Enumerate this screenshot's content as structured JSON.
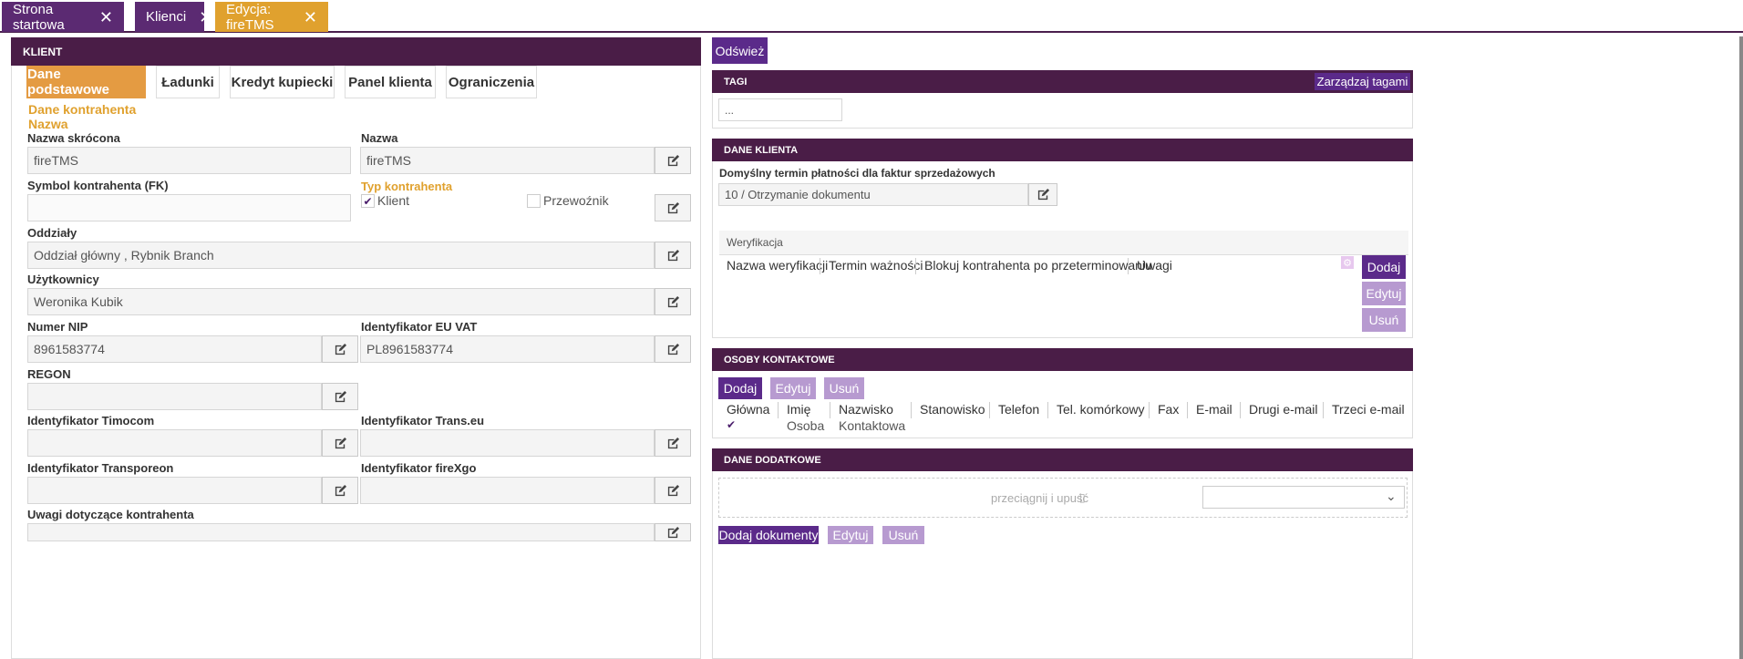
{
  "top_tabs": [
    {
      "label": "Strona startowa"
    },
    {
      "label": "Klienci"
    },
    {
      "label": "Edycja: fireTMS"
    }
  ],
  "left_panel": {
    "title": "KLIENT",
    "tabs": [
      "Dane podstawowe",
      "Ładunki",
      "Kredyt kupiecki",
      "Panel klienta",
      "Ograniczenia"
    ],
    "section_title": "Dane kontrahenta",
    "section_sub": "Nazwa",
    "fields": {
      "nazwa_skrocona_label": "Nazwa skrócona",
      "nazwa_skrocona_value": "fireTMS",
      "nazwa_label": "Nazwa",
      "nazwa_value": "fireTMS",
      "symbol_label": "Symbol kontrahenta (FK)",
      "symbol_value": "",
      "typ_label": "Typ kontrahenta",
      "klient_label": "Klient",
      "przewoznik_label": "Przewoźnik",
      "oddzialy_label": "Oddziały",
      "oddzialy_value": "Oddział główny , Rybnik Branch",
      "uzytkownicy_label": "Użytkownicy",
      "uzytkownicy_value": "Weronika Kubik",
      "nip_label": "Numer NIP",
      "nip_value": "8961583774",
      "euvat_label": "Identyfikator EU VAT",
      "euvat_value": "PL8961583774",
      "regon_label": "REGON",
      "regon_value": "",
      "timocom_label": "Identyfikator Timocom",
      "transeu_label": "Identyfikator Trans.eu",
      "transporeon_label": "Identyfikator Transporeon",
      "firexgo_label": "Identyfikator fireXgo",
      "uwagi_label": "Uwagi dotyczące kontrahenta"
    }
  },
  "right": {
    "refresh_label": "Odśwież",
    "tags": {
      "title": "TAGI",
      "manage_label": "Zarządzaj tagami",
      "input_value": "..."
    },
    "client_data": {
      "title": "DANE KLIENTA",
      "payment_label": "Domyślny termin płatności dla faktur sprzedażowych",
      "payment_value": "10 / Otrzymanie dokumentu",
      "verification_title": "Weryfikacja",
      "columns": [
        "Nazwa weryfikacji",
        "Termin ważności",
        "Blokuj kontrahenta po przeterminowaniu",
        "Uwagi"
      ],
      "add_label": "Dodaj",
      "edit_label": "Edytuj",
      "delete_label": "Usuń"
    },
    "contacts": {
      "title": "OSOBY KONTAKTOWE",
      "add_label": "Dodaj",
      "edit_label": "Edytuj",
      "delete_label": "Usuń",
      "columns": [
        "Główna",
        "Imię",
        "Nazwisko",
        "Stanowisko",
        "Telefon",
        "Tel. komórkowy",
        "Fax",
        "E-mail",
        "Drugi e-mail",
        "Trzeci e-mail"
      ],
      "row": {
        "imie": "Osoba",
        "nazwisko": "Kontaktowa"
      }
    },
    "extra": {
      "title": "DANE DODATKOWE",
      "drop_label": "przeciągnij i upuść",
      "add_docs_label": "Dodaj dokumenty",
      "edit_label": "Edytuj",
      "delete_label": "Usuń"
    }
  },
  "colors": {
    "header_purple": "#4a1d47",
    "tab_purple": "#5b2a72",
    "accent_orange": "#e0a12e",
    "button_purple": "#5b2a8a",
    "button_disabled": "#b79ad0"
  }
}
